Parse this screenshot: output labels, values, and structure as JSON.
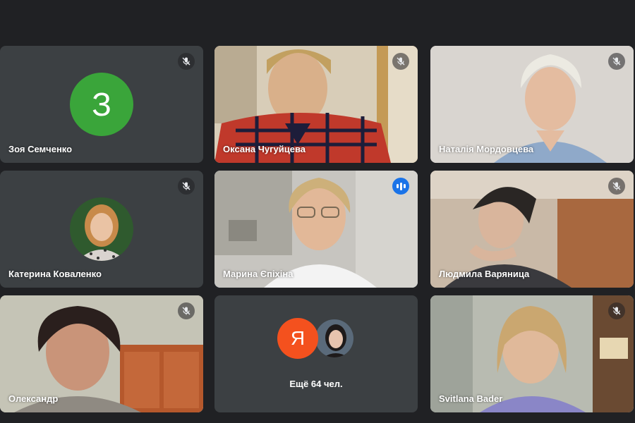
{
  "participants": [
    {
      "name": "Зоя Семченко",
      "initial": "З",
      "avatar_color": "#3aa53a",
      "muted": true
    },
    {
      "name": "Оксана Чугуйцева",
      "muted": true
    },
    {
      "name": "Наталія Мордовцева",
      "muted": true
    },
    {
      "name": "Катерина Коваленко",
      "muted": true
    },
    {
      "name": "Марина Єпіхіна",
      "muted": false,
      "speaking": true
    },
    {
      "name": "Людмила Варяница",
      "muted": true
    },
    {
      "name": "Олександр",
      "muted": true
    },
    {
      "name": "Svitlana Bader",
      "muted": true
    }
  ],
  "more": {
    "label": "Ещё 64 чел.",
    "initial": "Я",
    "avatar_color": "#f4511e"
  },
  "colors": {
    "background": "#202124",
    "tile": "#3c4043",
    "active_border": "#8ab4f8",
    "speaking_badge": "#1a73e8"
  }
}
